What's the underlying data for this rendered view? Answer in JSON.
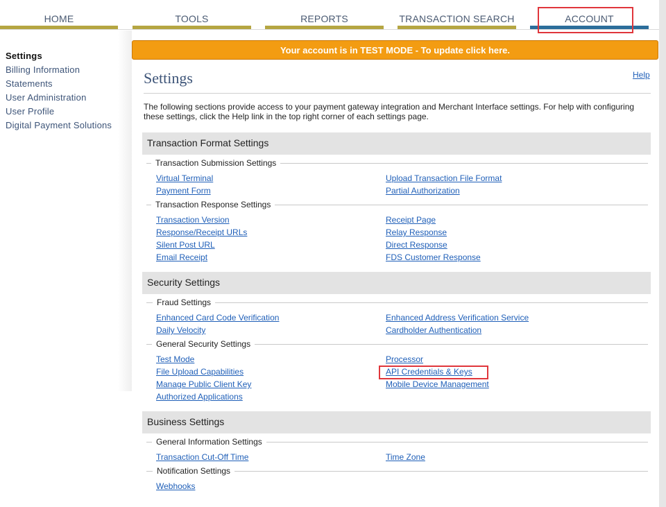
{
  "nav": {
    "home": "HOME",
    "tools": "TOOLS",
    "reports": "REPORTS",
    "transaction_search": "TRANSACTION SEARCH",
    "account": "ACCOUNT"
  },
  "sidebar": {
    "items": [
      {
        "label": "Settings"
      },
      {
        "label": "Billing Information"
      },
      {
        "label": "Statements"
      },
      {
        "label": "User Administration"
      },
      {
        "label": "User Profile"
      },
      {
        "label": "Digital Payment Solutions"
      }
    ]
  },
  "banner": {
    "text": "Your account is in TEST MODE - To update click here."
  },
  "page": {
    "title": "Settings",
    "help": "Help",
    "intro": "The following sections provide access to your payment gateway integration and Merchant Interface settings. For help with configuring these settings, click the Help link in the top right corner of each settings page."
  },
  "sections": {
    "transaction_format": {
      "title": "Transaction Format Settings",
      "submission": {
        "label": "Transaction Submission Settings",
        "left": [
          "Virtual Terminal",
          "Payment Form"
        ],
        "right": [
          "Upload Transaction File Format",
          "Partial Authorization"
        ]
      },
      "response": {
        "label": "Transaction Response Settings",
        "left": [
          "Transaction Version",
          "Response/Receipt URLs",
          "Silent Post URL",
          "Email Receipt"
        ],
        "right": [
          "Receipt Page",
          "Relay Response",
          "Direct Response",
          "FDS Customer Response"
        ]
      }
    },
    "security": {
      "title": "Security Settings",
      "fraud": {
        "label": "Fraud Settings",
        "left": [
          "Enhanced Card Code Verification",
          "Daily Velocity"
        ],
        "right": [
          "Enhanced Address Verification Service",
          "Cardholder Authentication"
        ]
      },
      "general": {
        "label": "General Security Settings",
        "left": [
          "Test Mode",
          "File Upload Capabilities",
          "Manage Public Client Key",
          "Authorized Applications"
        ],
        "right": [
          "Processor",
          "API Credentials & Keys",
          "Mobile Device Management"
        ]
      }
    },
    "business": {
      "title": "Business Settings",
      "general_info": {
        "label": "General Information Settings",
        "left": [
          "Transaction Cut-Off Time"
        ],
        "right": [
          "Time Zone"
        ]
      },
      "notification": {
        "label": "Notification Settings",
        "left": [
          "Webhooks"
        ]
      }
    }
  },
  "colors": {
    "nav_bar": "#b5a642",
    "nav_active": "#2c6e9b",
    "banner": "#f39c12",
    "link": "#1f5fb8",
    "highlight": "#e0363b"
  }
}
